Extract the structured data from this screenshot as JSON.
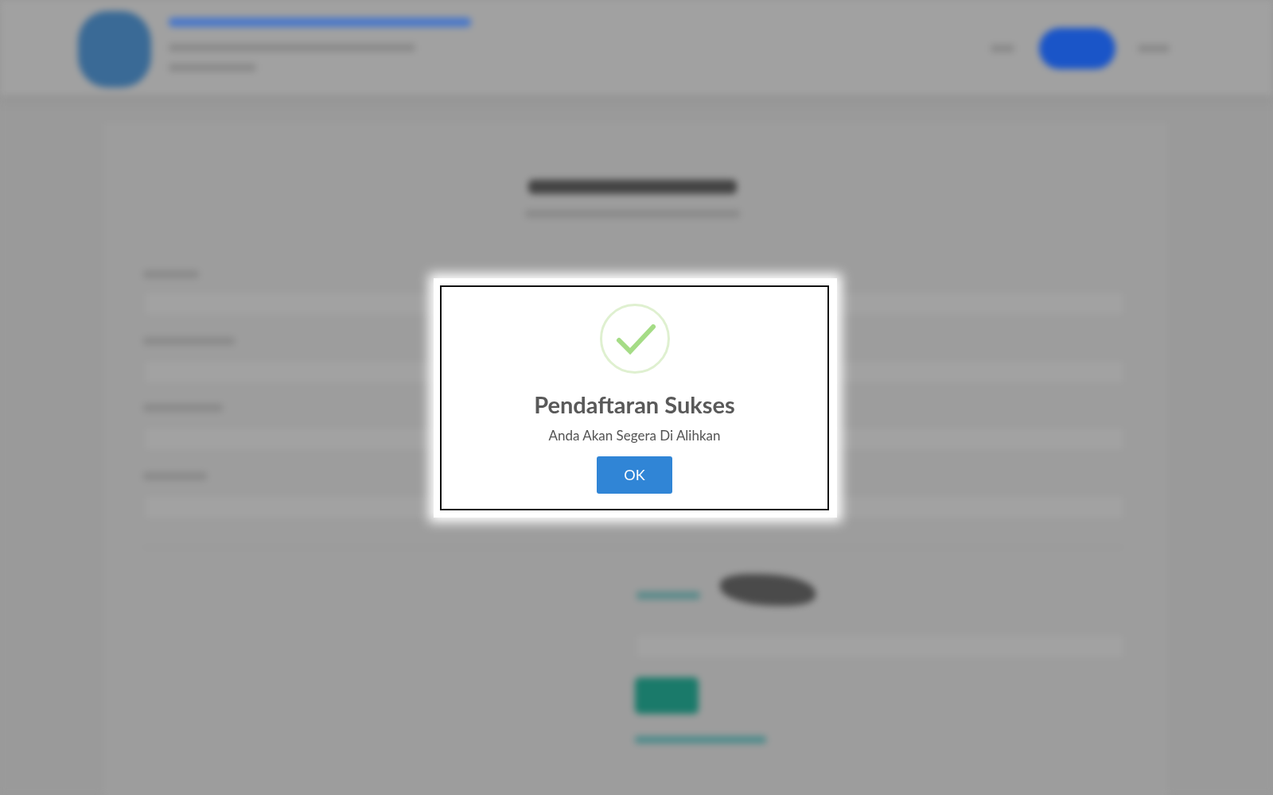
{
  "dialog": {
    "title": "Pendaftaran Sukses",
    "message": "Anda Akan Segera Di Alihkan",
    "button": "OK"
  }
}
